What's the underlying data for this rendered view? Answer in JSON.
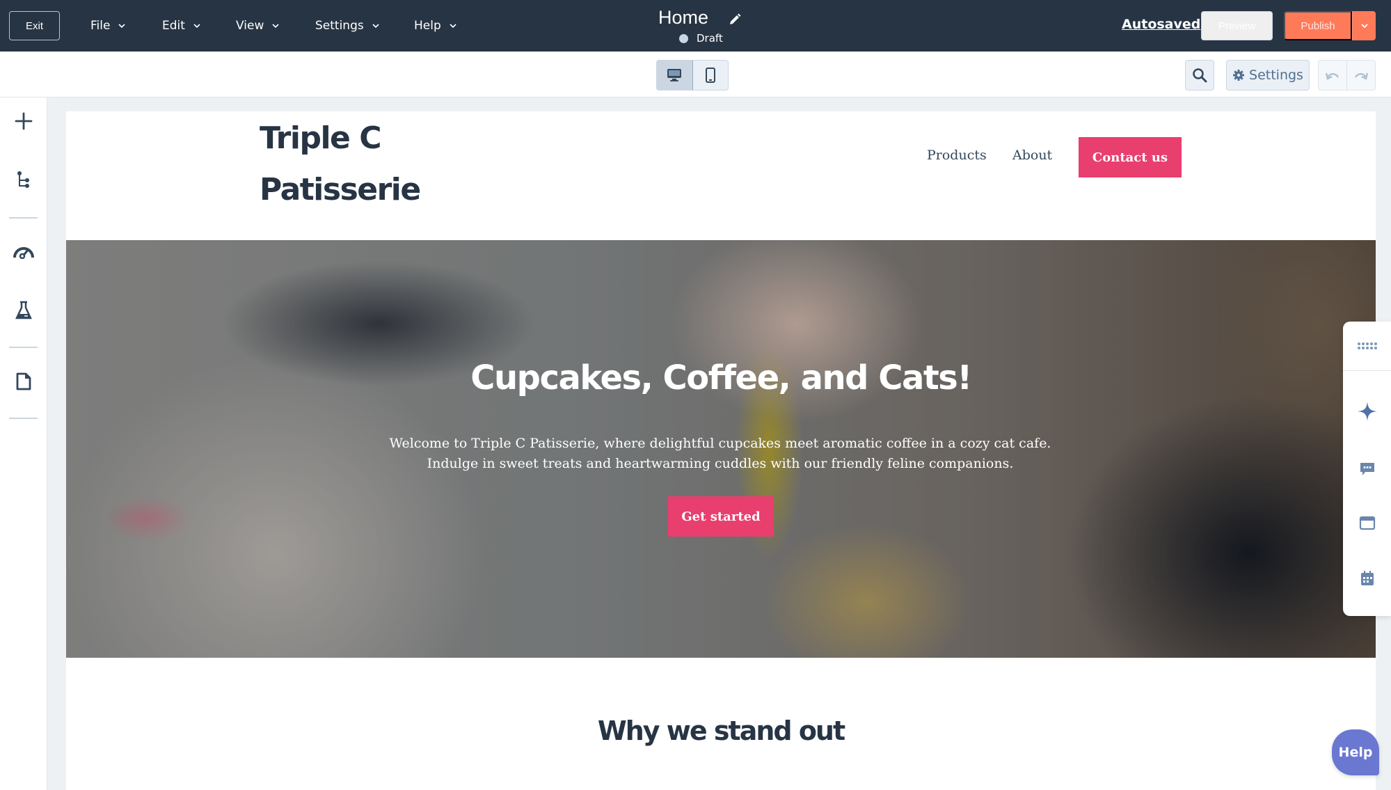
{
  "topbar": {
    "exit_label": "Exit",
    "menus": [
      {
        "label": "File"
      },
      {
        "label": "Edit"
      },
      {
        "label": "View"
      },
      {
        "label": "Settings"
      },
      {
        "label": "Help"
      }
    ],
    "page_title": "Home",
    "status": "Draft",
    "autosaved_label": "Autosaved",
    "preview_label": "Preview",
    "publish_label": "Publish"
  },
  "toolbar": {
    "device_modes": [
      "desktop",
      "mobile"
    ],
    "active_device": "desktop",
    "settings_label": "Settings",
    "icons": {
      "search": "search-icon",
      "settings": "gear-icon",
      "undo": "undo-icon",
      "redo": "redo-icon"
    }
  },
  "left_sidebar": {
    "items": [
      {
        "icon": "plus-icon",
        "name": "add"
      },
      {
        "icon": "tree-structure-icon",
        "name": "layers"
      },
      {
        "icon": "speedometer-icon",
        "name": "optimize"
      },
      {
        "icon": "flask-icon",
        "name": "test"
      },
      {
        "icon": "document-icon",
        "name": "pages"
      }
    ]
  },
  "site": {
    "logo_line1": "Triple C",
    "logo_line2": "Patisserie",
    "nav": [
      {
        "label": "Products"
      },
      {
        "label": "About"
      }
    ],
    "contact_label": "Contact us",
    "hero": {
      "title": "Cupcakes, Coffee, and Cats!",
      "text": "Welcome to Triple C Patisserie, where delightful cupcakes meet aromatic coffee in a cozy cat cafe. Indulge in sweet treats and heartwarming cuddles with our friendly feline companions.",
      "cta_label": "Get started"
    },
    "section_title": "Why we stand out"
  },
  "right_panel": {
    "items": [
      {
        "icon": "grid-dots-icon"
      },
      {
        "icon": "sparkle-icon"
      },
      {
        "icon": "chat-icon"
      },
      {
        "icon": "window-icon"
      },
      {
        "icon": "calendar-icon"
      }
    ]
  },
  "help_label": "Help",
  "colors": {
    "topbar_bg": "#273444",
    "publish": "#ff7a59",
    "brand_pink": "#e83f6f",
    "help_fab": "#6a78d1",
    "text_dark": "#273444"
  }
}
